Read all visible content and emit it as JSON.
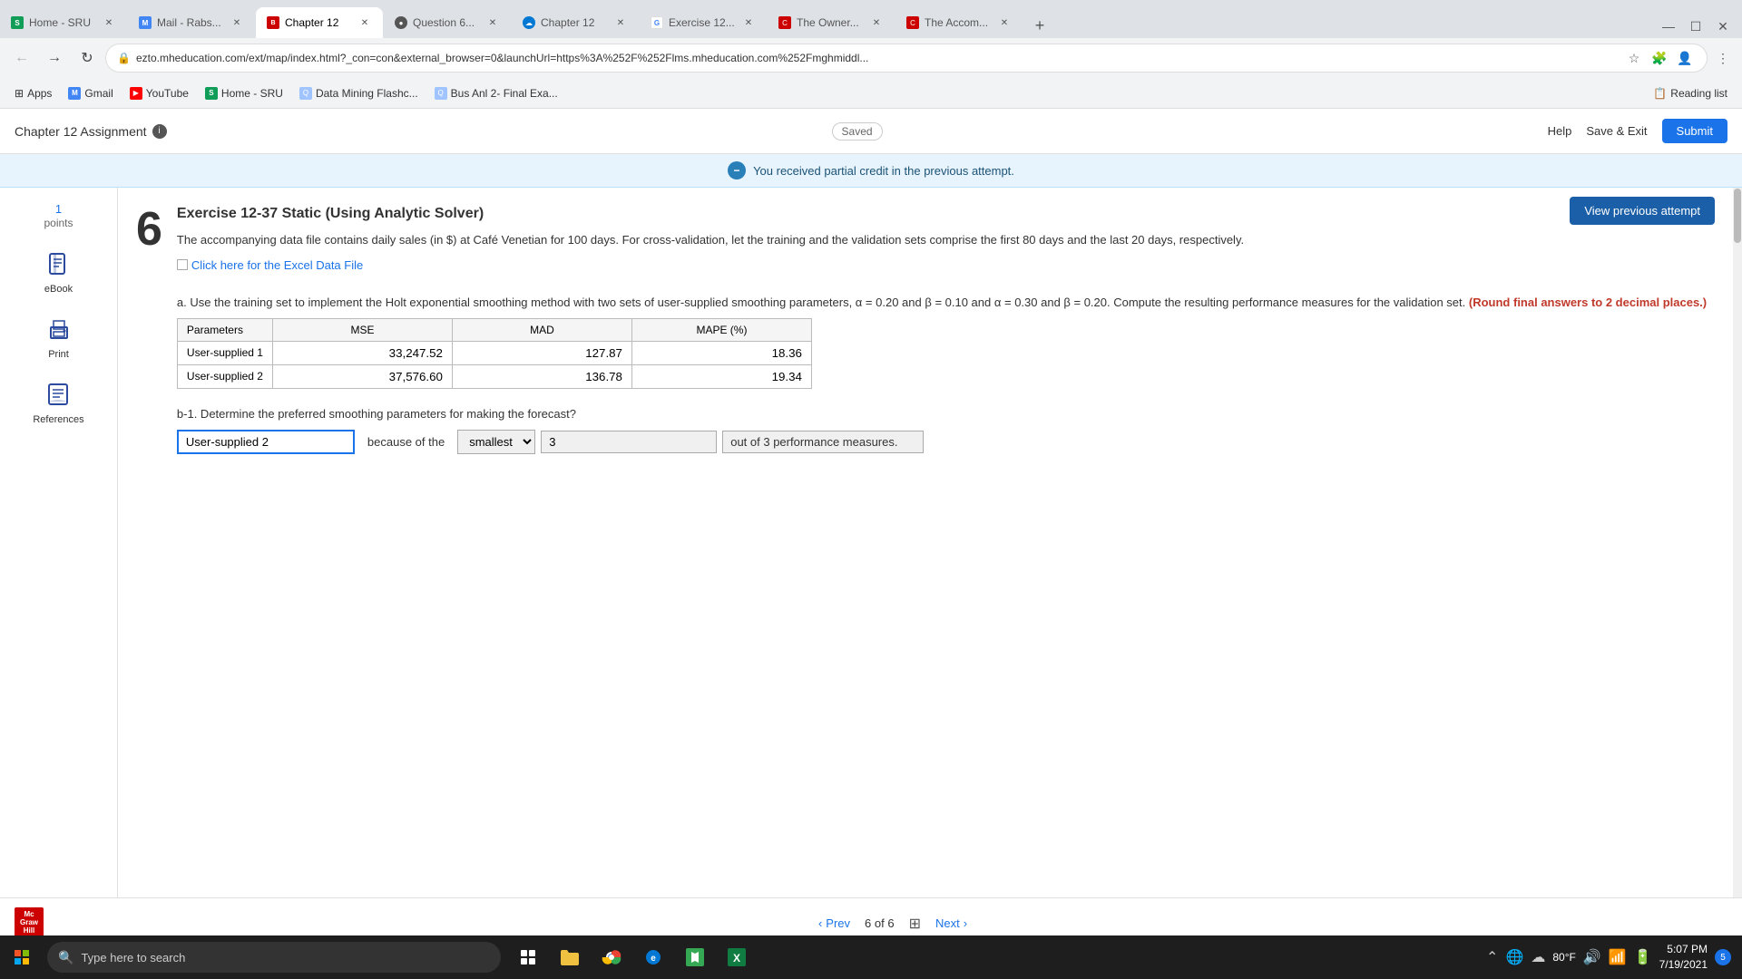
{
  "browser": {
    "tabs": [
      {
        "id": "home-sru",
        "title": "Home - SRU",
        "favicon_type": "sheets",
        "favicon_text": "S",
        "active": false
      },
      {
        "id": "mail-rabs",
        "title": "Mail - Rabs...",
        "favicon_type": "mail",
        "favicon_text": "M",
        "active": false
      },
      {
        "id": "chapter12-mh",
        "title": "Chapter 12",
        "favicon_type": "mh",
        "favicon_text": "B",
        "active": true
      },
      {
        "id": "question6",
        "title": "Question 6...",
        "favicon_type": "globe",
        "favicon_text": "●",
        "active": false
      },
      {
        "id": "chapter12-cloud",
        "title": "Chapter 12",
        "favicon_type": "cloud",
        "favicon_text": "☁",
        "active": false
      },
      {
        "id": "exercise12",
        "title": "Exercise 12...",
        "favicon_type": "google",
        "favicon_text": "G",
        "active": false
      },
      {
        "id": "the-owner",
        "title": "The Owner...",
        "favicon_type": "owner",
        "favicon_text": "C",
        "active": false
      },
      {
        "id": "the-accom",
        "title": "The Accom...",
        "favicon_type": "owner",
        "favicon_text": "C",
        "active": false
      }
    ],
    "address": "ezto.mheducation.com/ext/map/index.html?_con=con&external_browser=0&launchUrl=https%3A%252F%252Flms.mheducation.com%252Fmghmiddl...",
    "bookmarks": [
      {
        "label": "Apps",
        "favicon": "grid"
      },
      {
        "label": "Gmail",
        "favicon": "mail"
      },
      {
        "label": "YouTube",
        "favicon": "yt"
      },
      {
        "label": "Home - SRU",
        "favicon": "sheets"
      },
      {
        "label": "Data Mining Flashc...",
        "favicon": "q"
      },
      {
        "label": "Bus Anl 2- Final Exa...",
        "favicon": "q"
      }
    ],
    "reading_list": "Reading list"
  },
  "assignment": {
    "title": "Chapter 12 Assignment",
    "info_tooltip": "i",
    "saved_label": "Saved",
    "help_label": "Help",
    "save_exit_label": "Save & Exit",
    "submit_label": "Submit"
  },
  "notification": {
    "text": "You received partial credit in the previous attempt."
  },
  "sidebar": {
    "points_value": "1",
    "points_label": "points",
    "tools": [
      {
        "label": "eBook",
        "icon": "book"
      },
      {
        "label": "Print",
        "icon": "print"
      },
      {
        "label": "References",
        "icon": "references"
      }
    ]
  },
  "question": {
    "number": "6",
    "title": "Exercise 12-37 Static (Using Analytic Solver)",
    "body_text": "The accompanying data file contains daily sales (in $) at Café Venetian for 100 days. For cross-validation, let the training and the validation sets comprise the first 80 days and the last 20 days, respectively.",
    "data_file_link": "Click here for the Excel Data File",
    "part_a_text": "a. Use the training set to implement the Holt exponential smoothing method with two sets of user-supplied smoothing parameters, α = 0.20 and β = 0.10 and α = 0.30 and β = 0.20. Compute the resulting performance measures for the validation set.",
    "round_note": "(Round final answers to 2 decimal places.)",
    "table": {
      "headers": [
        "Parameters",
        "MSE",
        "MAD",
        "MAPE (%)"
      ],
      "rows": [
        {
          "param": "User-supplied 1",
          "mse": "33,247.52",
          "mad": "127.87",
          "mape": "18.36"
        },
        {
          "param": "User-supplied 2",
          "mse": "37,576.60",
          "mad": "136.78",
          "mape": "19.34"
        }
      ]
    },
    "part_b1_label": "b-1. Determine the preferred smoothing parameters for making the forecast?",
    "b1_answer": "User-supplied 2",
    "b1_because": "because of the",
    "b1_select": "smallest",
    "b1_num": "3",
    "b1_suffix": "out of 3 performance measures."
  },
  "view_prev_btn": "View previous attempt",
  "pagination": {
    "prev_label": "Prev",
    "page_current": "6",
    "page_total": "6",
    "next_label": "Next"
  },
  "taskbar": {
    "search_placeholder": "Type here to search",
    "clock": {
      "time": "5:07 PM",
      "date": "7/19/2021"
    },
    "notification_count": "5"
  },
  "mcgraw": {
    "line1": "Mc",
    "line2": "Graw",
    "line3": "Hill"
  }
}
